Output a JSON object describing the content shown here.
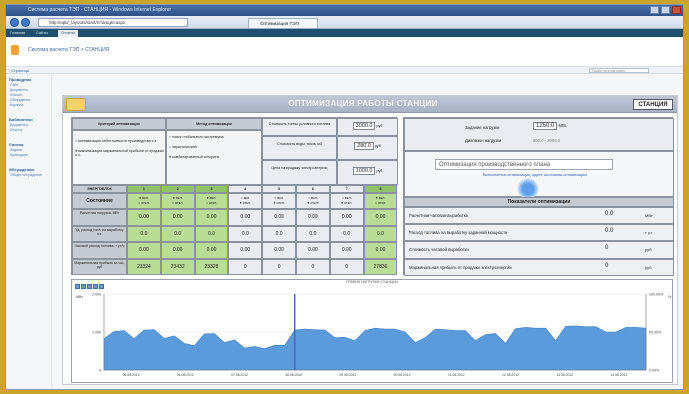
{
  "window": {
    "title": "Система расчета ТЭП - СТАНЦИЯ - Windows Internet Explorer",
    "address": "http://opti/_layouts/start/Станция.aspx",
    "tab": "Оптимизация ТЭП"
  },
  "menubar": {
    "items": [
      "Главная",
      "Сайты",
      "Отчеты"
    ],
    "active_index": 2
  },
  "site": {
    "breadcrumb": "Система расчета ТЭП > СТАНЦИЯ",
    "subbar_label": "Страница",
    "search_placeholder": "Поиск на этом сайте"
  },
  "sidebar": {
    "sections": [
      {
        "title": "Проводник",
        "items": [
          "Сайт",
          "Документы",
          "Списки",
          "Обсуждения",
          "Корзина"
        ]
      },
      {
        "title": "Библиотеки",
        "items": [
          "Документы",
          "Отчеты"
        ]
      },
      {
        "title": "Списки",
        "items": [
          "Задачи",
          "Календарь"
        ]
      },
      {
        "title": "Обсуждения",
        "items": [
          "Общее обсуждение"
        ]
      }
    ]
  },
  "panel": {
    "title": "ОПТИМИЗАЦИЯ РАБОТЫ СТАНЦИИ",
    "tab_label": "СТАНЦИЯ"
  },
  "table": {
    "criterion_header": "Критерий оптимизации",
    "criterion_options": [
      "минимизация себестоимости производства э.э.",
      "максимизация маржинальной прибыли от продажи э.э."
    ],
    "method_header": "Метод оптимизации",
    "method_options": [
      "поиск глобального экстремума",
      "эвристический",
      "комбинированный алгоритм"
    ],
    "fuel_cost_label": "Стоимость тонны условного топлива",
    "fuel_cost_value": "3000.0",
    "fuel_cost_unit": "руб",
    "water_cost_label": "Стоимость воды, тысяч м3",
    "water_cost_value": "280.0",
    "water_cost_unit": "руб",
    "power_price_label": "Цена на продажу электроэнергии",
    "power_price_value": "1000.0",
    "power_price_unit": "руб",
    "units_header": "ЭНЕРГОБЛОК",
    "unit_numbers": [
      "1",
      "2",
      "3",
      "4",
      "5",
      "6",
      "7",
      "8"
    ],
    "state_label": "Состояние",
    "state_on": "вкл.",
    "state_off": "откл.",
    "unit_on": [
      true,
      true,
      true,
      false,
      false,
      false,
      false,
      true
    ],
    "rows": [
      {
        "label": "Расчетная нагрузка, МВт",
        "values": [
          "0.00",
          "0.00",
          "0.00",
          "0.00",
          "0.00",
          "0.00",
          "0.00",
          "0.00"
        ]
      },
      {
        "label": "Уд. расход топл. на выработку э.э.",
        "values": [
          "0.0",
          "0.0",
          "0.0",
          "0.0",
          "0.0",
          "0.0",
          "0.0",
          "0.0"
        ]
      },
      {
        "label": "Часовой расход топлива, т у.т/ч",
        "values": [
          "0.00",
          "0.00",
          "0.00",
          "0.00",
          "0.00",
          "0.00",
          "0.00",
          "0.00"
        ]
      },
      {
        "label": "Маржинальная прибыль за час, руб",
        "values": [
          "23324",
          "23432",
          "23328",
          "0",
          "0",
          "0",
          "0",
          "27836"
        ]
      }
    ]
  },
  "right": {
    "load_label": "Задание нагрузки",
    "load_value": "1250.0",
    "load_unit": "МВт",
    "range_label": "Диапазон нагрузки",
    "range_from": "500.0",
    "range_to": "2000.0",
    "opt_input_value": "Оптимизация производственного плана",
    "opt_status": "Выполняется оптимизация, ждите окончания оптимизации!",
    "indicators_header": "Показатели оптимизации",
    "indicators": [
      {
        "label": "Расчетная часовая выработка",
        "value": "0.0",
        "unit": "МВт"
      },
      {
        "label": "Расход топлива на выработку заданной мощности",
        "value": "0.0",
        "unit": "т у.т"
      },
      {
        "label": "Стоимость часовой выработки",
        "value": "0",
        "unit": "руб"
      },
      {
        "label": "Маржинальная прибыль от продажи электроэнергии",
        "value": "0",
        "unit": "руб"
      }
    ]
  },
  "chart_data": {
    "type": "area",
    "title": "ГРАФИК НАГРУЗКИ СТАНЦИИ",
    "ylabel_left": "МВт",
    "ylabel_right": "%",
    "y_left_ticks": [
      "2 000",
      "1 000",
      "0"
    ],
    "y_right_ticks": [
      "100.00%",
      "50.00%",
      "0.00%"
    ],
    "ylim": [
      0,
      2000
    ],
    "x_ticks": [
      "05.08.2012",
      "06.08.2012",
      "07.08.2012",
      "08.08.2012",
      "09.08.2012",
      "10.08.2012",
      "11.08.2012",
      "12.08.2012",
      "13.08.2012",
      "14.08.2012"
    ],
    "series": [
      {
        "name": "Нагрузка",
        "color": "#5b9bdc",
        "values": [
          820,
          1010,
          1040,
          820,
          1050,
          1060,
          830,
          900,
          700,
          640,
          950,
          960,
          720,
          790,
          580,
          620,
          560,
          650,
          650,
          1050,
          1080,
          1060,
          1050,
          850,
          860,
          770,
          1040,
          1100,
          1080,
          1080,
          1000,
          720,
          850,
          1070,
          1060,
          1040,
          1040,
          770,
          930,
          960,
          700,
          1090,
          1120,
          1100,
          1100,
          770,
          1150,
          1160,
          1140,
          1140,
          1000,
          1000,
          1120,
          1120,
          1100
        ]
      }
    ],
    "marker_index": 19,
    "grid": true
  },
  "colors": {
    "unit_on": "#8ec36a",
    "unit_cell": "#b9dc96",
    "area_fill": "#5b9bdc",
    "marker": "#3f62b5"
  }
}
